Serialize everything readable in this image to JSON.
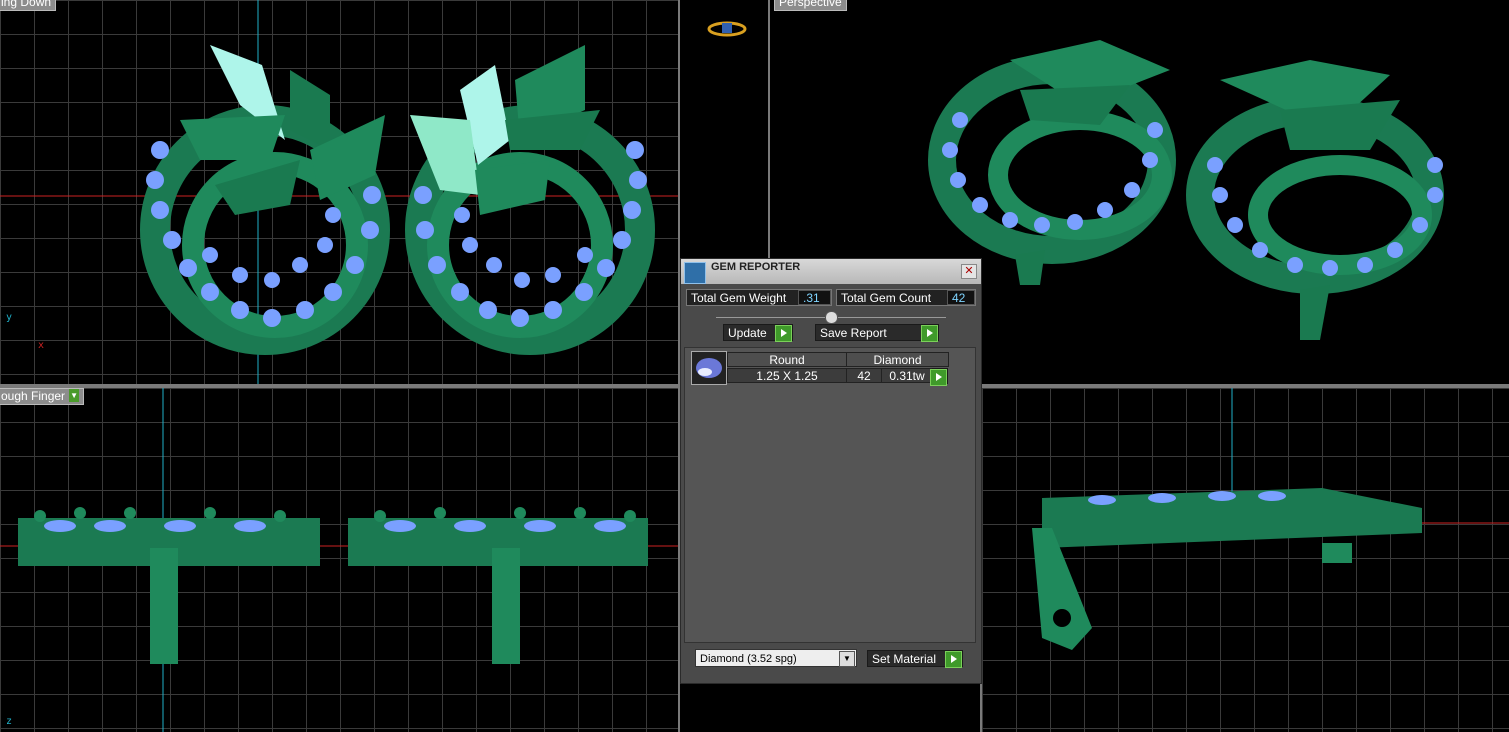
{
  "viewports": {
    "top": {
      "label": "ing Down"
    },
    "perspective": {
      "label": "Perspective"
    },
    "front": {
      "label": "ough Finger"
    }
  },
  "axes": {
    "x": "x",
    "y": "y",
    "z": "z"
  },
  "gem_reporter": {
    "title": "GEM REPORTER",
    "close_label": "✕",
    "total_weight_label": "Total Gem Weight",
    "total_weight_value": ".31",
    "total_count_label": "Total Gem Count",
    "total_count_value": "42",
    "update_label": "Update",
    "save_report_label": "Save Report",
    "table": {
      "headers": [
        "Round",
        "Diamond"
      ],
      "row": {
        "size": "1.25 X 1.25",
        "count": "42",
        "weight": "0.31tw"
      }
    },
    "material_select": "Diamond      (3.52 spg)",
    "set_material_label": "Set Material"
  },
  "colors": {
    "metal": "#1f8a5c",
    "leaf_selected": "#9ff0e2",
    "gem": "#7aa0ff",
    "axis_x": "#cc2222",
    "axis_y": "#1fb0c8"
  }
}
